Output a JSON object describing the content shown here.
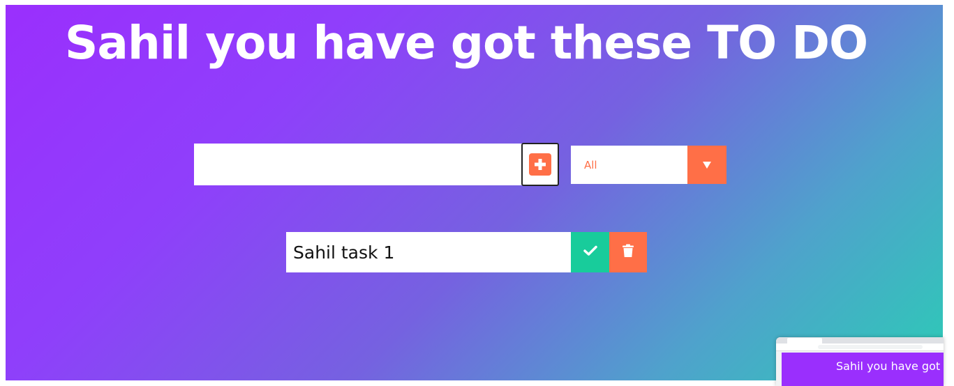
{
  "header": {
    "title": "Sahil you have got these TO DO"
  },
  "form": {
    "input_value": "",
    "input_placeholder": "",
    "add_icon": "plus-square-icon",
    "filter": {
      "selected": "All",
      "arrow_icon": "caret-down-icon"
    }
  },
  "todos": [
    {
      "text": "Sahil task 1",
      "complete_icon": "check-icon",
      "delete_icon": "trash-icon"
    }
  ],
  "preview": {
    "title": "Sahil you have got"
  },
  "colors": {
    "accent": "#ff6f47",
    "complete": "#18cc9b",
    "gradient_start": "#9a2ffd",
    "gradient_end": "#2ccbb6"
  }
}
